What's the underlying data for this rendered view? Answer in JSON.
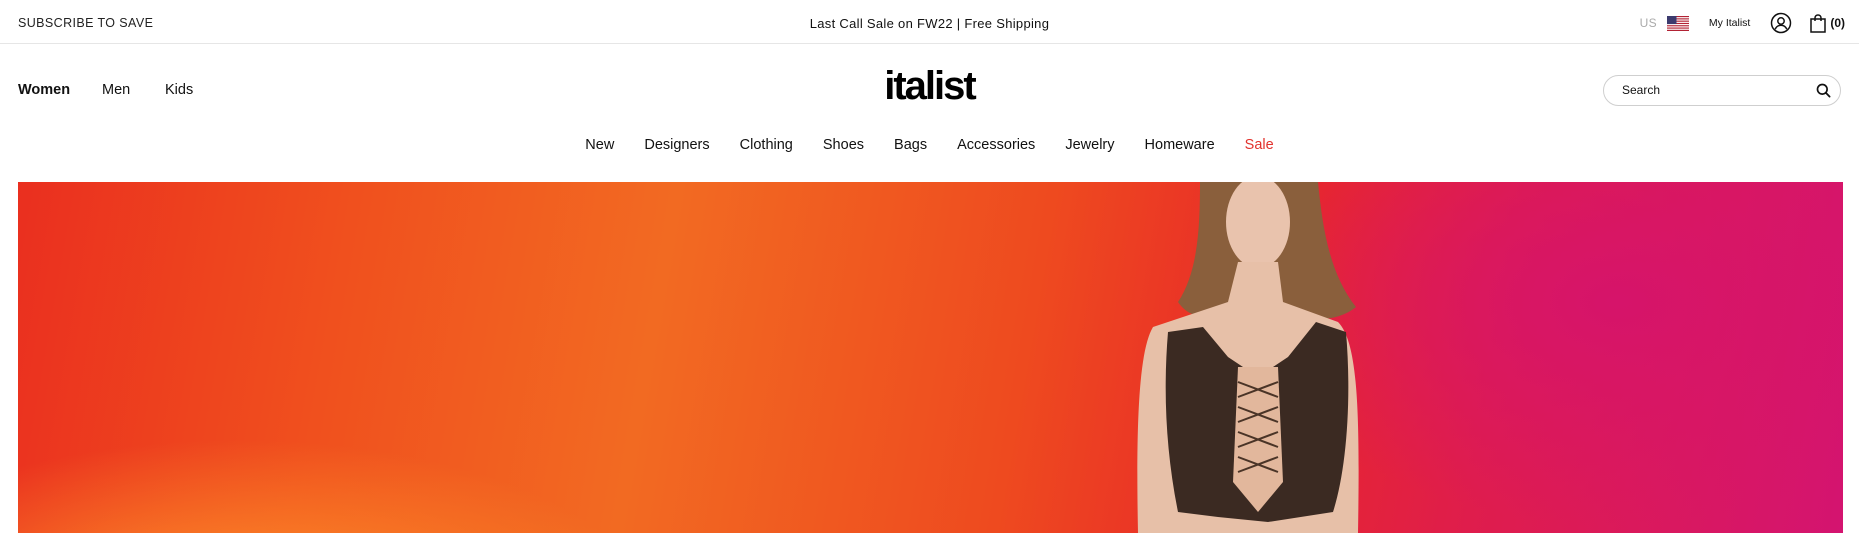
{
  "topbar": {
    "subscribe_label": "SUBSCRIBE TO SAVE",
    "promo_text": "Last Call Sale on FW22 | Free Shipping",
    "country_code": "US",
    "flag_icon": "us-flag-icon",
    "my_account_label": "My Italist",
    "account_icon": "user-icon",
    "cart_icon": "shopping-bag-icon",
    "cart_count": "(0)"
  },
  "header": {
    "genders": [
      "Women",
      "Men",
      "Kids"
    ],
    "active_gender": "Women",
    "logo_text": "italist",
    "search": {
      "placeholder": "Search",
      "icon": "search-icon"
    }
  },
  "categories": {
    "items": [
      "New",
      "Designers",
      "Clothing",
      "Shoes",
      "Bags",
      "Accessories",
      "Jewelry",
      "Homeware",
      "Sale"
    ],
    "sale_color": "#e2322d"
  },
  "hero": {
    "gradient_colors": [
      "#ea2f1f",
      "#f26a22",
      "#ff9a2a",
      "#d41470"
    ]
  }
}
